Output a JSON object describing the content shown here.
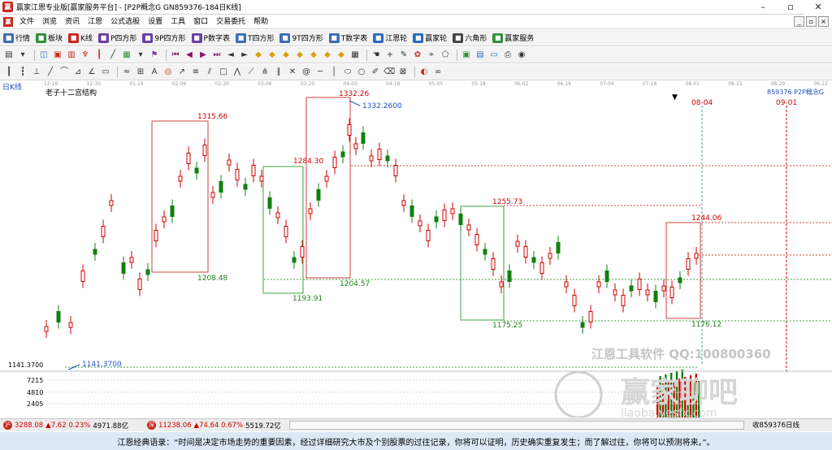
{
  "window": {
    "app_icon": "赢",
    "title": "赢家江恩专业版[赢家服务平台] - [P2P概念G  GN859376-184日K线]",
    "minimize": "–",
    "restore": "▫",
    "close": "✕"
  },
  "menubar": {
    "items": [
      "文件",
      "浏览",
      "资讯",
      "江恩",
      "公式选股",
      "设置",
      "工具",
      "窗口",
      "交易委托",
      "帮助"
    ],
    "mdi": [
      "_",
      "▫",
      "×"
    ]
  },
  "toolbar": {
    "items": [
      {
        "label": "行情",
        "icon": "grid-icon",
        "color": "#3b6db3"
      },
      {
        "label": "板块",
        "icon": "board-icon",
        "color": "#2f8f3b"
      },
      {
        "label": "K线",
        "icon": "kline-icon",
        "color": "#c8281e"
      },
      {
        "label": "P四方形",
        "icon": "square-icon",
        "color": "#6b3fa0"
      },
      {
        "label": "9P四方形",
        "icon": "square9-icon",
        "color": "#6b3fa0"
      },
      {
        "label": "P数字表",
        "icon": "number-table-icon",
        "color": "#6b3fa0"
      },
      {
        "label": "T四方形",
        "icon": "t-square-icon",
        "color": "#3b6db3"
      },
      {
        "label": "9T四方形",
        "icon": "t-square9-icon",
        "color": "#3b6db3"
      },
      {
        "label": "T数字表",
        "icon": "t-number-table-icon",
        "color": "#3b6db3"
      },
      {
        "label": "江恩轮",
        "icon": "gann-wheel-icon",
        "color": "#2a6cc0"
      },
      {
        "label": "赢家轮",
        "icon": "winner-wheel-icon",
        "color": "#2a6cc0"
      },
      {
        "label": "六角形",
        "icon": "hexagon-icon",
        "color": "#444444"
      },
      {
        "label": "赢家服务",
        "icon": "dollar-icon",
        "color": "#2f8f3b"
      }
    ]
  },
  "chart": {
    "period_label": "日K线",
    "indicator_name": "老子十二宫结构",
    "code_label": "859376 P2P概念G",
    "date_ticks": [
      "12-16",
      "12-30",
      "01-16",
      "02-06",
      "02-20",
      "03-06",
      "03-20",
      "04-03",
      "04-18",
      "05-05",
      "05-18",
      "06-02",
      "06-16",
      "07-04",
      "07-18",
      "08-01",
      "08-15",
      "08-29",
      "09-12"
    ],
    "marker_date_1": "08-04",
    "marker_date_2": "09-01",
    "price_axis": "1141.3700",
    "volume_ticks": [
      "7215",
      "4810",
      "2405"
    ],
    "levels": {
      "h1": "1315.66",
      "l1": "1208.48",
      "h2": "1284.30",
      "l2": "1193.91",
      "h3": "1332.26",
      "h3b": "1332.2600",
      "l3": "1204.57",
      "h4": "1255.73",
      "l4": "1175.25",
      "h5": "1244.06",
      "l5": "1176.12",
      "low": "1141.3700"
    },
    "watermark1": "江恩工具软件  QQ:100800360",
    "watermark2": "赢家聊吧",
    "watermark3": "liaoba.yesfx.com"
  },
  "statusbar": {
    "index1_price": "3288.08",
    "index1_change": "▲7.62 0.23%",
    "index1_amount": "4971.88亿",
    "index2_price": "11238.06",
    "index2_change": "▲74.64 0.67%",
    "index2_amount": "5519.72亿",
    "right_label": "收859376日线"
  },
  "quote": {
    "text": "江恩经典语录：“时间是决定市场走势的重要因素，经过详细研究大市及个别股票的过往记录，你将可以证明，历史确实重复发生；而了解过往，你将可以预测将来。”。"
  }
}
